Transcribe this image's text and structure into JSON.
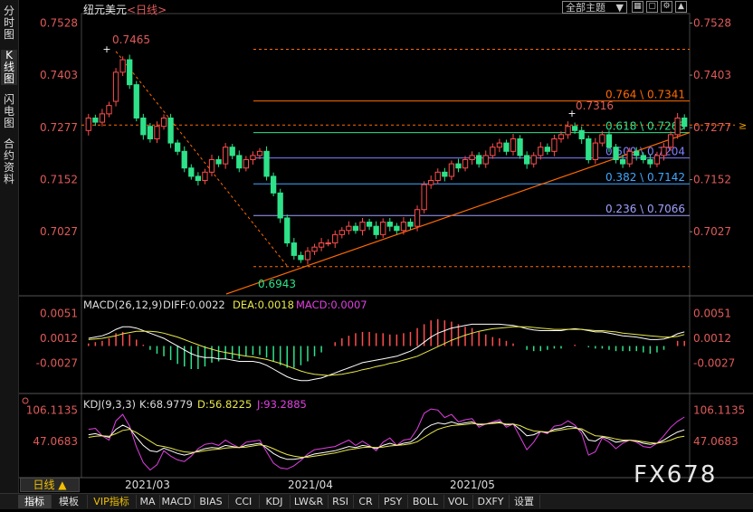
{
  "header": {
    "symbol": "纽元美元",
    "period_tag": "<日线>",
    "theme_label": "全部主题",
    "icons": [
      "grid-icon",
      "window-icon",
      "settings-icon",
      "arrow-up-icon",
      "arrow-down-icon"
    ]
  },
  "left_tabs": [
    {
      "label": "分时图",
      "active": false
    },
    {
      "label": "K线图",
      "active": true
    },
    {
      "label": "闪电图",
      "active": false
    },
    {
      "label": "合约资料",
      "active": false
    }
  ],
  "period_button": "日线 ▲",
  "bottom_tabs": [
    "指标",
    "模板",
    "VIP指标",
    "MA",
    "MACD",
    "BIAS",
    "CCI",
    "KDJ",
    "LW&R",
    "RSI",
    "CR",
    "PSY",
    "BOLL",
    "VOL",
    "DXFY",
    "设置"
  ],
  "watermark": "FX678",
  "colors": {
    "up": "#ff4d4d",
    "down": "#2ee28a",
    "ma_diff": "#ffffff",
    "ma_dea": "#e8e84a",
    "kdj_j": "#e040e0",
    "fib": "#ff6a00"
  },
  "chart_data": [
    {
      "type": "candlestick",
      "title": "纽元美元 日线",
      "x_labels": [
        "2021/03",
        "2021/04",
        "2021/05"
      ],
      "y_ticks": [
        "0.7528",
        "0.7403",
        "0.7277",
        "0.7152",
        "0.7027"
      ],
      "ylim": [
        0.6943,
        0.7528
      ],
      "last_price": "0.7280",
      "annotations": [
        {
          "label": "0.7465",
          "color": "#e05a5a"
        },
        {
          "label": "0.6943",
          "color": "#2ee28a"
        },
        {
          "label": "0.7316",
          "color": "#e05a5a"
        }
      ],
      "fib_levels": [
        {
          "label": "0.764 \\ 0.7341",
          "value": 0.7341,
          "color": "#ff6a00"
        },
        {
          "label": "0.618 \\ 0.7265",
          "value": 0.7265,
          "color": "#2ee28a"
        },
        {
          "label": "0.500 \\ 0.7204",
          "value": 0.7204,
          "color": "#8080ff"
        },
        {
          "label": "0.382 \\ 0.7142",
          "value": 0.7142,
          "color": "#3fa8ff"
        },
        {
          "label": "0.236 \\ 0.7066",
          "value": 0.7066,
          "color": "#a0a0ff"
        }
      ],
      "trendline": {
        "from": [
          0.69,
          0.0
        ],
        "to": [
          0.727,
          1.0
        ]
      },
      "closes": [
        0.73,
        0.729,
        0.731,
        0.733,
        0.741,
        0.744,
        0.738,
        0.73,
        0.726,
        0.725,
        0.728,
        0.73,
        0.724,
        0.722,
        0.718,
        0.716,
        0.715,
        0.717,
        0.72,
        0.719,
        0.723,
        0.721,
        0.718,
        0.72,
        0.721,
        0.722,
        0.716,
        0.712,
        0.706,
        0.7,
        0.697,
        0.696,
        0.698,
        0.699,
        0.7,
        0.7,
        0.702,
        0.703,
        0.704,
        0.703,
        0.705,
        0.704,
        0.702,
        0.705,
        0.704,
        0.703,
        0.705,
        0.704,
        0.708,
        0.714,
        0.715,
        0.717,
        0.716,
        0.719,
        0.718,
        0.72,
        0.721,
        0.719,
        0.721,
        0.723,
        0.724,
        0.722,
        0.725,
        0.721,
        0.719,
        0.721,
        0.723,
        0.722,
        0.725,
        0.726,
        0.728,
        0.727,
        0.725,
        0.72,
        0.724,
        0.726,
        0.723,
        0.72,
        0.719,
        0.722,
        0.721,
        0.72,
        0.719,
        0.721,
        0.723,
        0.726,
        0.73,
        0.728
      ],
      "opens": [
        0.727,
        0.73,
        0.729,
        0.731,
        0.734,
        0.741,
        0.744,
        0.738,
        0.73,
        0.728,
        0.725,
        0.728,
        0.73,
        0.724,
        0.722,
        0.718,
        0.716,
        0.715,
        0.717,
        0.72,
        0.719,
        0.723,
        0.721,
        0.718,
        0.72,
        0.721,
        0.722,
        0.716,
        0.712,
        0.706,
        0.7,
        0.697,
        0.696,
        0.698,
        0.699,
        0.7,
        0.7,
        0.702,
        0.703,
        0.704,
        0.703,
        0.705,
        0.704,
        0.702,
        0.705,
        0.704,
        0.703,
        0.705,
        0.704,
        0.708,
        0.714,
        0.715,
        0.717,
        0.716,
        0.719,
        0.718,
        0.72,
        0.721,
        0.719,
        0.721,
        0.723,
        0.724,
        0.722,
        0.725,
        0.721,
        0.719,
        0.721,
        0.723,
        0.722,
        0.725,
        0.726,
        0.728,
        0.727,
        0.725,
        0.72,
        0.724,
        0.726,
        0.723,
        0.72,
        0.719,
        0.722,
        0.721,
        0.72,
        0.719,
        0.721,
        0.723,
        0.726,
        0.73
      ]
    },
    {
      "type": "macd",
      "title": "MACD(26,12,9)",
      "labels": {
        "diff": "DIFF:0.0022",
        "dea": "DEA:0.0018",
        "macd": "MACD:0.0007"
      },
      "y_ticks": [
        "0.0051",
        "0.0012",
        "-0.0027"
      ],
      "ylim": [
        -0.006,
        0.006
      ],
      "diff": [
        0.0012,
        0.0014,
        0.0016,
        0.002,
        0.0026,
        0.003,
        0.003,
        0.0028,
        0.0024,
        0.002,
        0.0016,
        0.0012,
        0.0006,
        0.0,
        -0.0006,
        -0.0012,
        -0.0016,
        -0.0018,
        -0.0018,
        -0.002,
        -0.002,
        -0.0022,
        -0.0024,
        -0.0024,
        -0.0024,
        -0.0026,
        -0.003,
        -0.0036,
        -0.0042,
        -0.0048,
        -0.0052,
        -0.0054,
        -0.0054,
        -0.0052,
        -0.005,
        -0.0046,
        -0.0042,
        -0.0038,
        -0.0034,
        -0.003,
        -0.0026,
        -0.0024,
        -0.0022,
        -0.002,
        -0.0018,
        -0.0016,
        -0.0012,
        -0.0008,
        -0.0002,
        0.0006,
        0.0014,
        0.002,
        0.0024,
        0.0028,
        0.003,
        0.0032,
        0.0034,
        0.0034,
        0.0034,
        0.0034,
        0.0034,
        0.0033,
        0.0032,
        0.003,
        0.0027,
        0.0025,
        0.0024,
        0.0024,
        0.0024,
        0.0024,
        0.0026,
        0.0027,
        0.0026,
        0.0024,
        0.0022,
        0.0022,
        0.002,
        0.0018,
        0.0016,
        0.0015,
        0.0014,
        0.0012,
        0.001,
        0.001,
        0.0011,
        0.0014,
        0.0019,
        0.0022
      ],
      "dea": [
        0.001,
        0.0011,
        0.0012,
        0.0014,
        0.0016,
        0.0019,
        0.0021,
        0.0023,
        0.0023,
        0.0023,
        0.0022,
        0.002,
        0.0017,
        0.0014,
        0.001,
        0.0006,
        0.0002,
        -0.0002,
        -0.0005,
        -0.0008,
        -0.001,
        -0.0012,
        -0.0014,
        -0.0016,
        -0.0017,
        -0.0019,
        -0.0021,
        -0.0024,
        -0.0027,
        -0.0031,
        -0.0035,
        -0.0039,
        -0.0042,
        -0.0044,
        -0.0045,
        -0.0046,
        -0.0045,
        -0.0044,
        -0.0042,
        -0.004,
        -0.0037,
        -0.0035,
        -0.0032,
        -0.003,
        -0.0027,
        -0.0025,
        -0.0022,
        -0.0019,
        -0.0016,
        -0.0011,
        -0.0006,
        -0.0001,
        0.0004,
        0.0009,
        0.0013,
        0.0017,
        0.002,
        0.0023,
        0.0025,
        0.0027,
        0.0028,
        0.0029,
        0.003,
        0.003,
        0.003,
        0.0029,
        0.0028,
        0.0027,
        0.0026,
        0.0026,
        0.0026,
        0.0026,
        0.0026,
        0.0025,
        0.0024,
        0.0024,
        0.0023,
        0.0022,
        0.002,
        0.0019,
        0.0018,
        0.0017,
        0.0016,
        0.0015,
        0.0014,
        0.0014,
        0.0015,
        0.0018
      ]
    },
    {
      "type": "kdj",
      "title": "KDJ(9,3,3)",
      "labels": {
        "k": "K:68.9779",
        "d": "D:56.8225",
        "j": "J:93.2885"
      },
      "y_ticks": [
        "106.1135",
        "47.0683"
      ],
      "ylim": [
        -10,
        115
      ],
      "k": [
        60,
        62,
        58,
        55,
        70,
        78,
        72,
        55,
        40,
        30,
        28,
        35,
        30,
        25,
        22,
        25,
        30,
        34,
        36,
        35,
        40,
        38,
        36,
        40,
        42,
        44,
        35,
        25,
        18,
        14,
        14,
        16,
        20,
        24,
        26,
        28,
        30,
        34,
        38,
        36,
        40,
        38,
        34,
        40,
        44,
        40,
        44,
        46,
        55,
        70,
        78,
        82,
        80,
        84,
        80,
        82,
        84,
        78,
        80,
        82,
        84,
        78,
        80,
        70,
        58,
        60,
        66,
        64,
        70,
        72,
        76,
        74,
        68,
        50,
        48,
        56,
        52,
        46,
        48,
        50,
        48,
        44,
        42,
        44,
        50,
        58,
        65,
        69
      ],
      "d": [
        55,
        57,
        58,
        57,
        62,
        68,
        70,
        64,
        56,
        48,
        40,
        38,
        35,
        31,
        28,
        27,
        28,
        30,
        32,
        33,
        35,
        36,
        36,
        37,
        39,
        41,
        39,
        34,
        28,
        23,
        20,
        18,
        18,
        20,
        22,
        24,
        26,
        29,
        32,
        34,
        36,
        37,
        36,
        37,
        39,
        40,
        41,
        43,
        47,
        55,
        63,
        70,
        74,
        77,
        78,
        79,
        81,
        80,
        80,
        81,
        82,
        80,
        80,
        77,
        71,
        67,
        66,
        65,
        67,
        69,
        71,
        72,
        71,
        64,
        58,
        57,
        55,
        52,
        50,
        50,
        49,
        47,
        45,
        44,
        46,
        50,
        55,
        57
      ],
      "j": [
        70,
        72,
        58,
        50,
        86,
        98,
        76,
        37,
        8,
        -6,
        4,
        30,
        20,
        13,
        10,
        20,
        34,
        42,
        44,
        40,
        50,
        42,
        36,
        46,
        48,
        50,
        28,
        7,
        -2,
        -4,
        2,
        12,
        24,
        32,
        34,
        36,
        38,
        44,
        50,
        40,
        48,
        40,
        30,
        46,
        54,
        40,
        50,
        52,
        71,
        100,
        108,
        106,
        92,
        98,
        84,
        88,
        90,
        74,
        80,
        84,
        88,
        74,
        80,
        56,
        32,
        46,
        66,
        62,
        76,
        78,
        86,
        78,
        62,
        22,
        28,
        54,
        46,
        34,
        44,
        50,
        46,
        38,
        36,
        44,
        58,
        74,
        85,
        93
      ]
    }
  ]
}
